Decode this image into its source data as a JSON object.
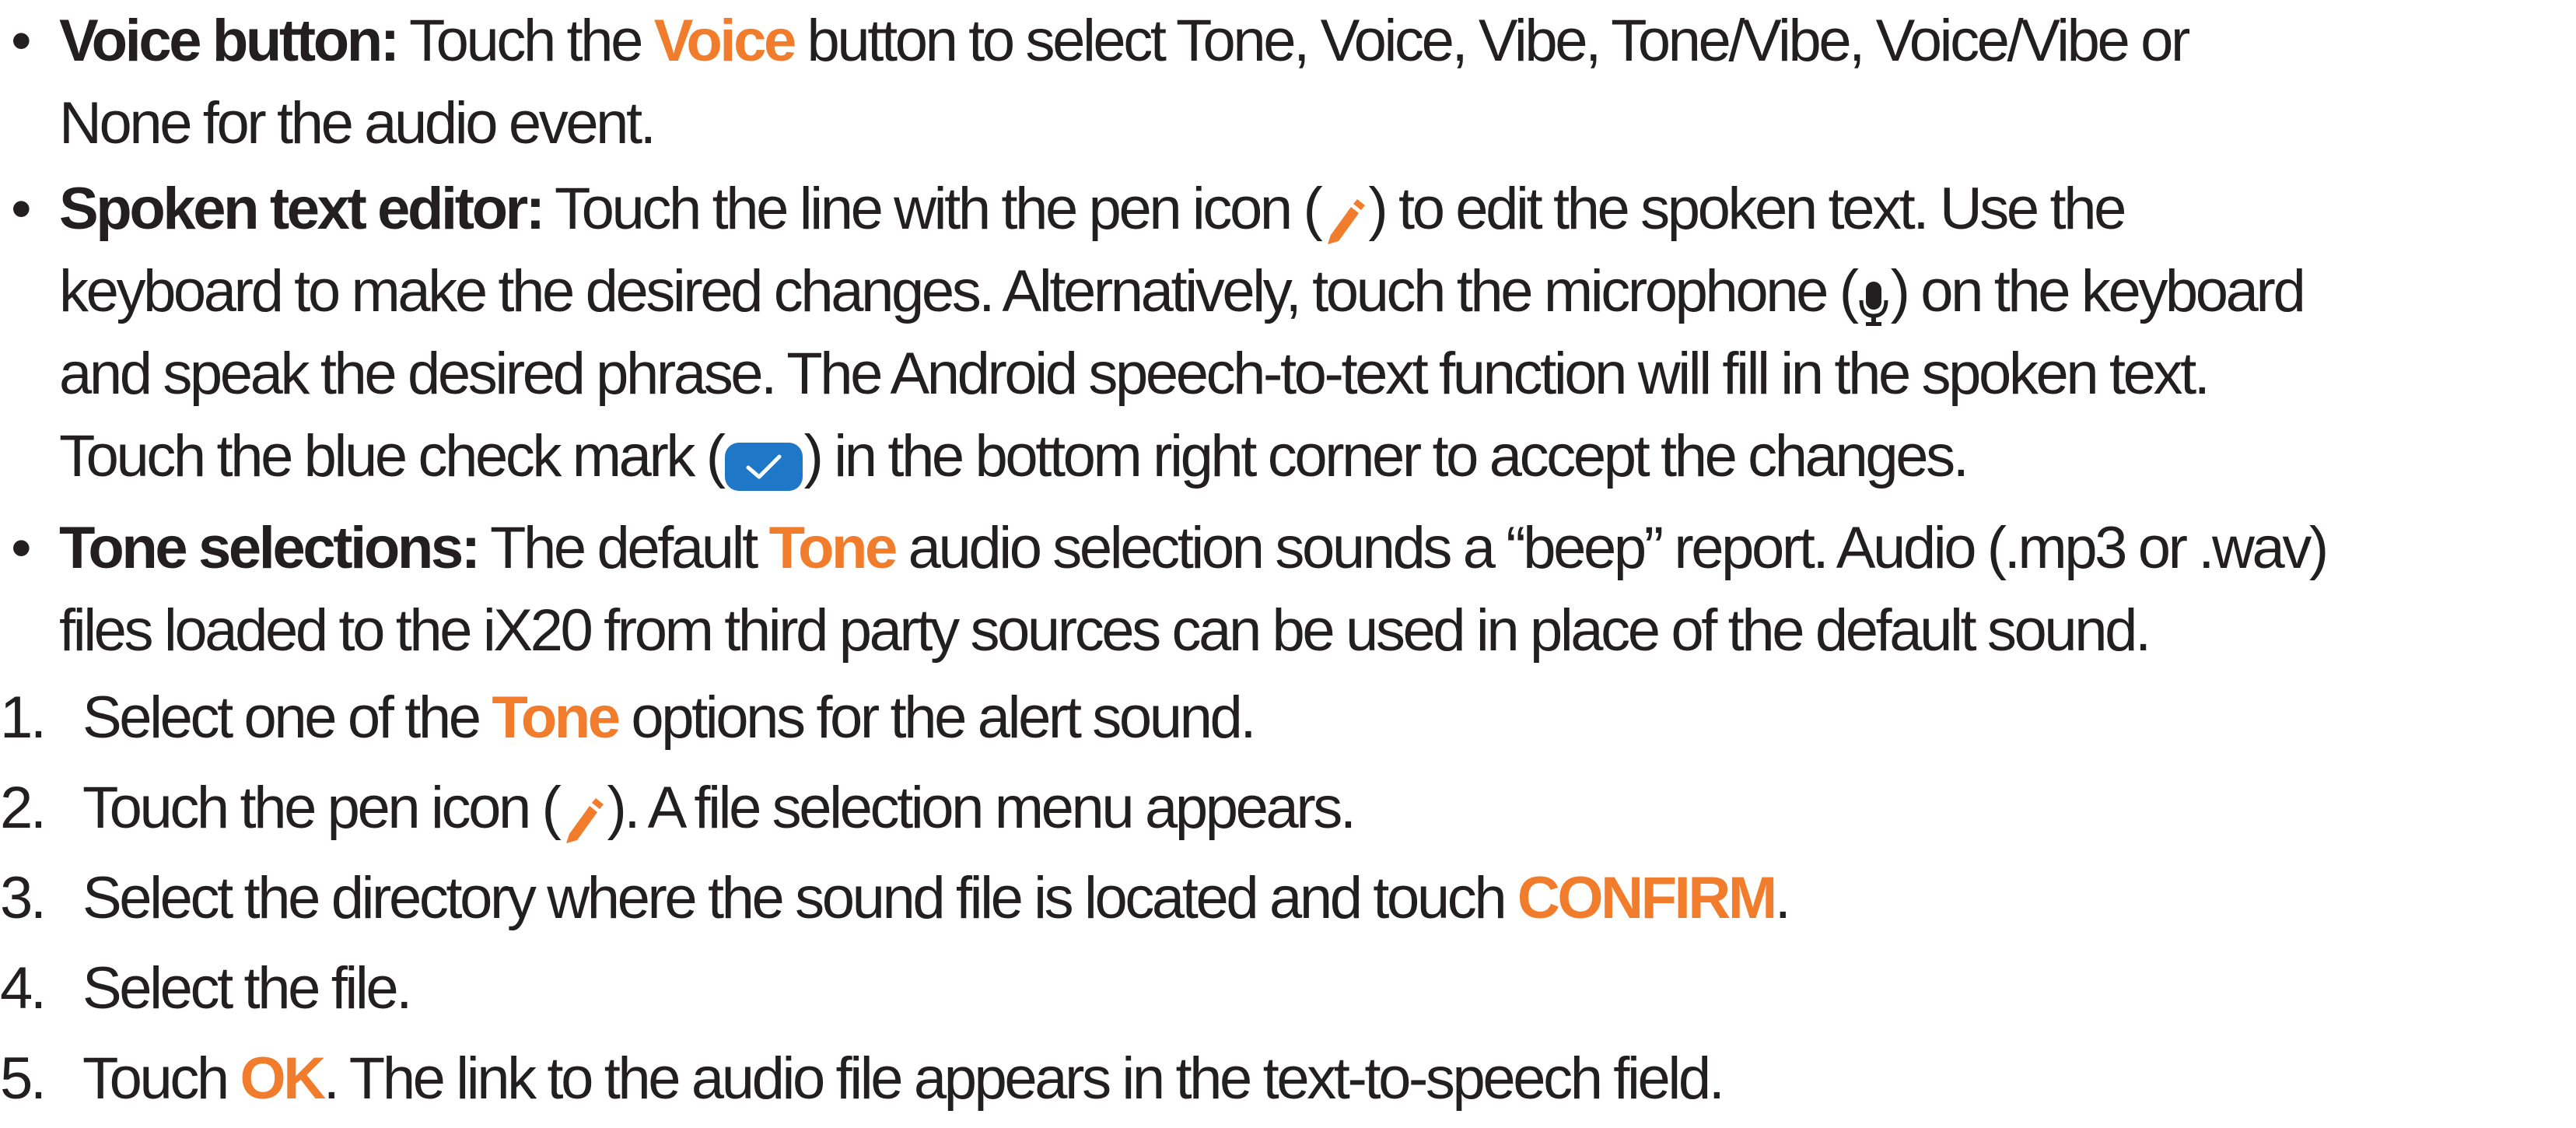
{
  "bullets": [
    {
      "marker": "•",
      "term": "Voice button:",
      "lines": [
        {
          "a": " Touch the ",
          "hl": "Voice",
          "b": " button to select Tone, Voice, Vibe, Tone/Vibe, Voice/Vibe or"
        },
        {
          "a": "None for the audio event."
        }
      ]
    },
    {
      "marker": "•",
      "term": "Spoken text editor:",
      "lines": [
        {
          "a": " Touch the line with the pen icon (",
          "icon": "pen-icon",
          "b": ") to edit the spoken text. Use the"
        },
        {
          "a": "keyboard to make the desired changes. Alternatively, touch the microphone (",
          "icon": "microphone-icon",
          "b": ") on the keyboard"
        },
        {
          "a": "and speak the desired phrase. The Android speech-to-text function will fill in the spoken text."
        },
        {
          "a": "Touch the blue check mark (",
          "icon": "check-mark-icon",
          "b": ") in the bottom right corner to accept the changes."
        }
      ]
    },
    {
      "marker": "•",
      "term": "Tone selections:",
      "lines": [
        {
          "a": " The default ",
          "hl": "Tone",
          "b": " audio selection sounds a “beep” report. Audio (.mp3 or .wav)"
        },
        {
          "a": "files loaded to the iX20 from third party sources can be used in place of the default sound."
        }
      ]
    }
  ],
  "steps": [
    {
      "marker": "1.",
      "a": "Select one of the ",
      "hl": "Tone",
      "b": " options for the alert sound."
    },
    {
      "marker": "2.",
      "a": "Touch the pen icon (",
      "icon": "pen-icon",
      "b": "). A file selection menu appears."
    },
    {
      "marker": "3.",
      "a": "Select the directory where the sound file is located and touch ",
      "hl": "CONFIRM",
      "b": "."
    },
    {
      "marker": "4.",
      "a": "Select the file."
    },
    {
      "marker": "5.",
      "a": "Touch ",
      "hl": "OK",
      "b": ". The link to the audio file appears in the text-to-speech field."
    }
  ],
  "colors": {
    "text": "#231f20",
    "highlight": "#f07c2c",
    "check_blue": "#1f77c8"
  }
}
